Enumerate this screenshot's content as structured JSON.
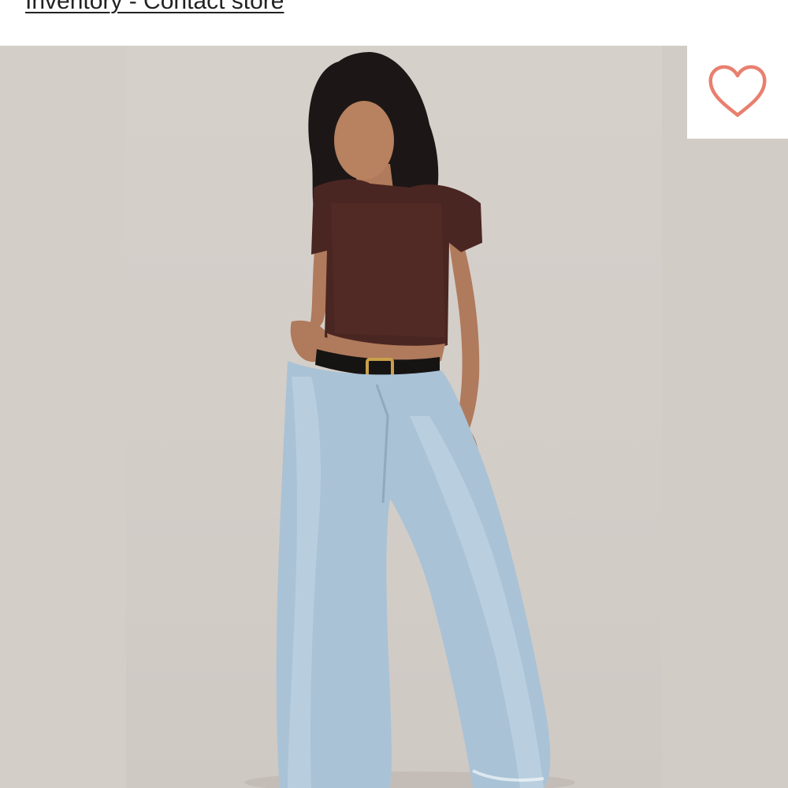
{
  "header": {
    "link_text": "Inventory - Contact store"
  },
  "product_image": {
    "alt": "Model wearing a brown sequin cropped tee with light-wash wide-leg jeans and black belt"
  },
  "favorite": {
    "icon": "heart-outline-icon",
    "color": "#e8806f"
  }
}
